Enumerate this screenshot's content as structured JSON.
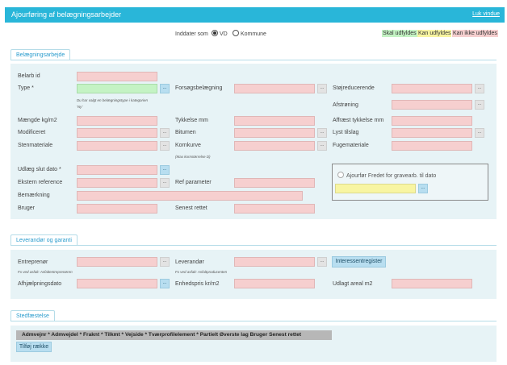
{
  "window": {
    "title": "Ajourføring af belægningsarbejder",
    "close_link": "Luk vindue"
  },
  "mode": {
    "label": "Inddater som",
    "options": [
      "VD",
      "Kommune"
    ],
    "selected": "VD"
  },
  "legend": [
    {
      "text": "Skal udfyldes",
      "color": "#c4f3c4"
    },
    {
      "text": "Kan udfyldes",
      "color": "#f8f5a2"
    },
    {
      "text": "Kan ikke udfyldes",
      "color": "#f6cfcf"
    }
  ],
  "belaegning": {
    "tab": "Belægningsarbejde",
    "fields": {
      "belarb_id": "Belarb id",
      "type": "Type *",
      "type_hint": "Du har valgt en belægningstype i kategorien",
      "type_cat": "'Ny'",
      "maengde": "Mængde kg/m2",
      "modificeret": "Modificeret",
      "stenmateriale": "Stenmateriale",
      "forsoeg": "Forsøgsbelægning",
      "tykkelse": "Tykkelse mm",
      "bitumen": "Bitumen",
      "kornkurve": "Kornkurve",
      "kornkurve_hint": "(Max kornstørrelse D)",
      "stoejreducerende": "Støjreducerende",
      "afstroening": "Afstrøning",
      "affraest": "Affræst tykkelse mm",
      "lyst_tilslag": "Lyst tilslag",
      "fugemateriale": "Fugemateriale",
      "udlaeg_slut": "Udlæg slut dato *",
      "ekstern_ref": "Ekstern reference",
      "bemaerkning": "Bemærkning",
      "bruger": "Bruger",
      "ref_parameter": "Ref parameter",
      "senest_rettet": "Senest rettet",
      "ajourfoer": "Ajourfør Fredet for gravearb. til dato"
    }
  },
  "leverandoer": {
    "tab": "Leverandør og garanti",
    "fields": {
      "entreprenoer": "Entreprenør",
      "entreprenoer_hint": "Fx ved asfalt: Asfaltentreprenøren",
      "leverandoer": "Leverandør",
      "leverandoer_hint": "Fx ved asfalt: Asfaltproducenten",
      "interessentregister": "Interessentregister",
      "afhjaelpningsdato": "Afhjælpningsdato",
      "enhedspris": "Enhedspris kr/m2",
      "udlagt_areal": "Udlagt areal m2"
    }
  },
  "stedfaestelse": {
    "tab": "Stedfæstelse",
    "columns": [
      "Admvejnr *",
      "Admvejdel *",
      "Fraknt *",
      "Tilkmt *",
      "Vejside *",
      "Tværprofilelement *",
      "Partielt",
      "Øverste lag",
      "Bruger",
      "Senest rettet"
    ],
    "add_row": "Tilføj række"
  },
  "button_dots": "..."
}
